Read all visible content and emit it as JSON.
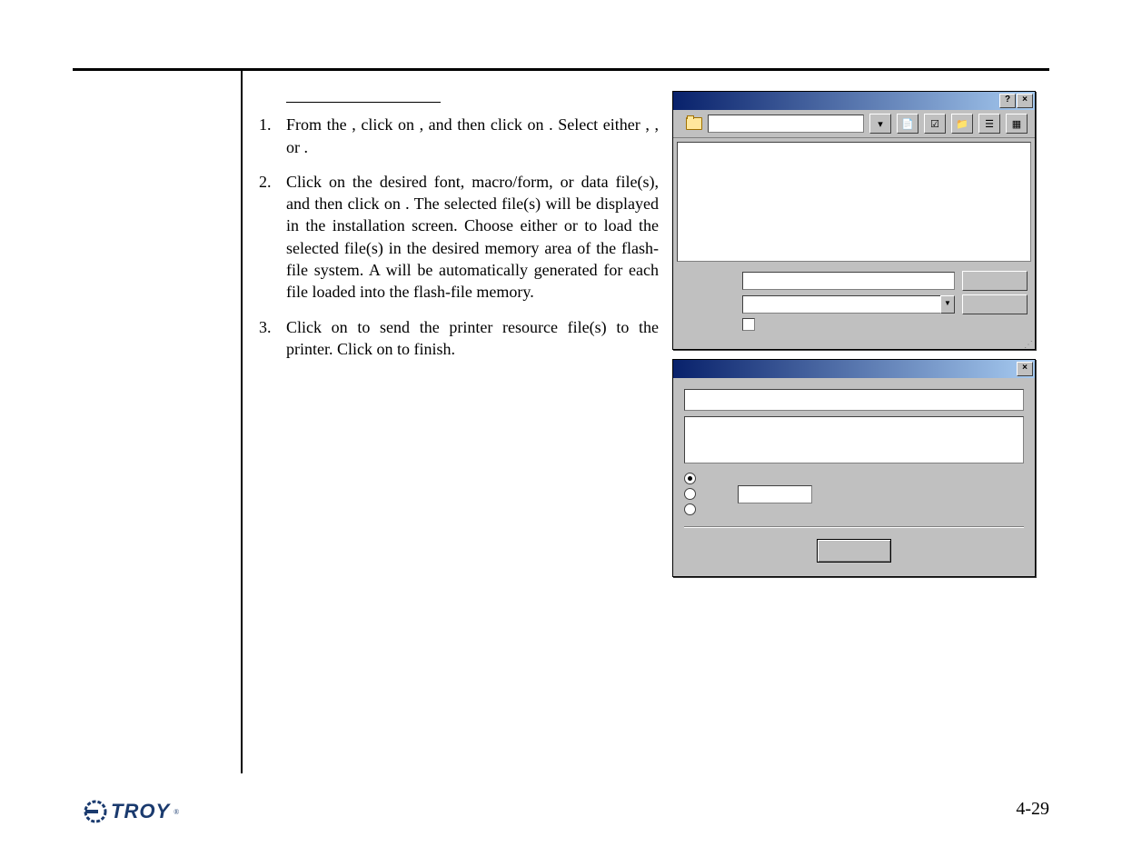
{
  "steps": [
    {
      "num": "1.",
      "pre": "From the ",
      "mid1": ", click on ",
      "mid2": ", and then click on ",
      "mid3": ".  Select either ",
      "mid4": ", ",
      "mid5": ", or ",
      "end": "."
    },
    {
      "num": "2.",
      "a": "Click on the desired font, macro/form, or data file(s), and then click on ",
      "b": ".  The selected file(s) will be displayed in the installation screen.  Choose either ",
      "c": " or ",
      "d": " to load the selected file(s) in the desired memory area of the flash-file system.  A ",
      "e": " will be automatically generated for each file loaded into the flash-file memory."
    },
    {
      "num": "3.",
      "a": "Click on ",
      "b": " to send the printer resource file(s) to the printer.  Click on ",
      "c": " to finish."
    }
  ],
  "open": {
    "title": "",
    "help": "?",
    "close": "×",
    "lookin": "",
    "name_lbl": "",
    "type_lbl": "",
    "open_btn": "",
    "cancel_btn": "",
    "ro_lbl": ""
  },
  "dlg2": {
    "title": "",
    "close": "×",
    "r1": "",
    "r2": "",
    "r3": "",
    "ok": ""
  },
  "page": "4-29",
  "brand": "TROY"
}
